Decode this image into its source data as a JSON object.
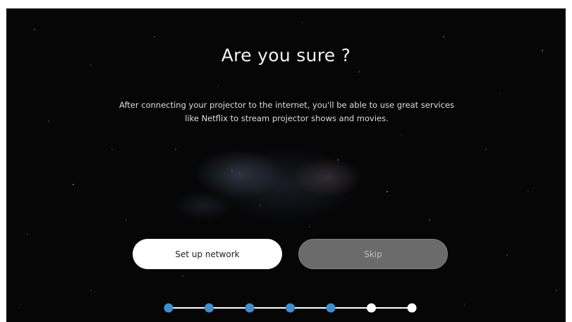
{
  "dialog": {
    "title": "Are you sure ?",
    "description": "After connecting your projector to the internet, you'll be able to use great services like Netflix to stream projector shows and movies."
  },
  "buttons": {
    "setup_network": "Set up network",
    "skip": "Skip"
  },
  "progress": {
    "total_steps": 7,
    "completed_steps": 5,
    "completed_color": "#3d8fd1",
    "pending_color": "#ffffff",
    "line_color": "#ffffff"
  },
  "colors": {
    "background": "#060607",
    "primary_button": "#ffffff",
    "secondary_button": "#6b6b6b"
  }
}
